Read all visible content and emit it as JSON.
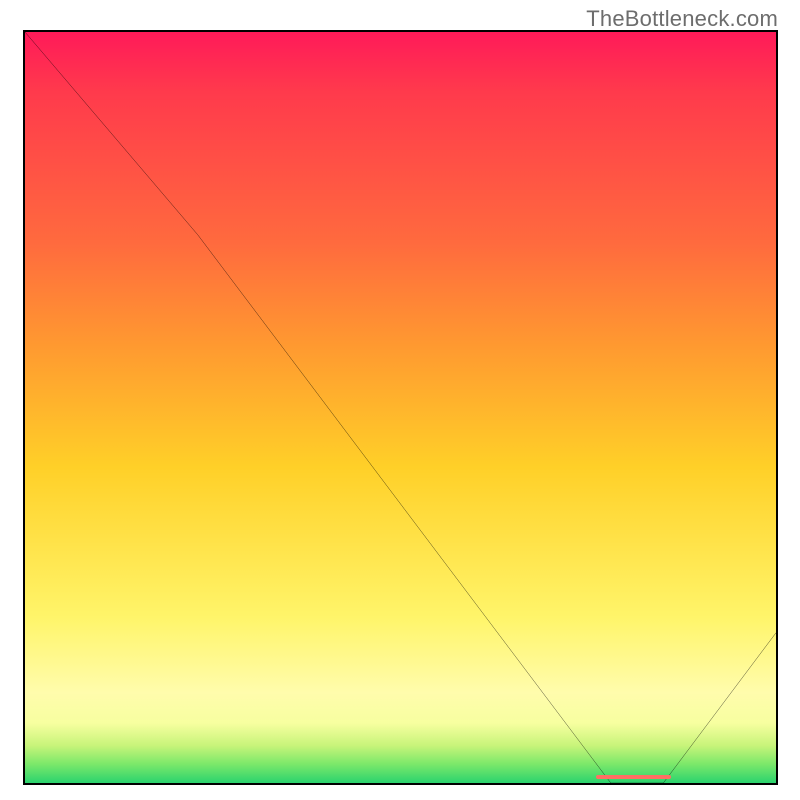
{
  "attribution": "TheBottleneck.com",
  "chart_data": {
    "type": "line",
    "title": "",
    "xlabel": "",
    "ylabel": "",
    "xlim": [
      0,
      100
    ],
    "ylim": [
      0,
      100
    ],
    "x": [
      0,
      23,
      78,
      85,
      100
    ],
    "values": [
      100,
      73,
      0,
      0,
      20
    ],
    "marker": {
      "x_start": 76,
      "x_end": 86,
      "y": 0.5
    }
  },
  "colors": {
    "curve": "#000000",
    "marker": "#ff6f63",
    "border": "#000000",
    "gradient_top": "#ff1a59",
    "gradient_bottom": "#2bd36e",
    "attribution": "#6d6d6d"
  }
}
